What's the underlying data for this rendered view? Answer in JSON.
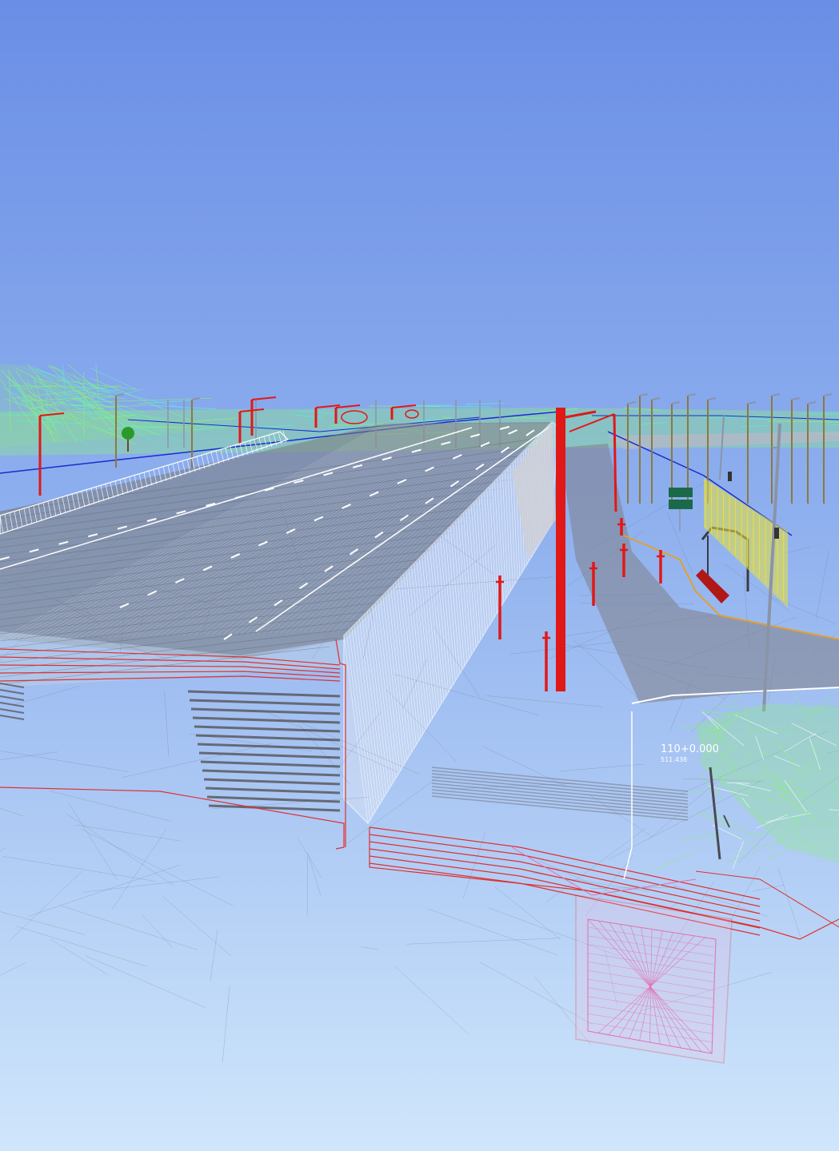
{
  "scene": {
    "station_label": "110+0.000",
    "station_sublabel": "511.438"
  },
  "colors": {
    "sky_top": "#6a8ee6",
    "sky_bottom": "#cfe6fb",
    "road_surface": "#7a7a7a",
    "lane_marking": "#ffffff",
    "wireframe_white": "#ffffff",
    "section_red": "#e03030",
    "foundation_pink": "#e070b0",
    "terrain_green": "#8af07a",
    "terrain_cyan": "#60e8d8",
    "utility_blue": "#1a2ad0",
    "pole_red": "#e01818",
    "pole_brown": "#8c7a3c",
    "pole_gray": "#8a94a8",
    "barrier_yellow": "#e8e040",
    "curb_orange": "#e0a030",
    "tree_green": "#2a9a2a"
  }
}
